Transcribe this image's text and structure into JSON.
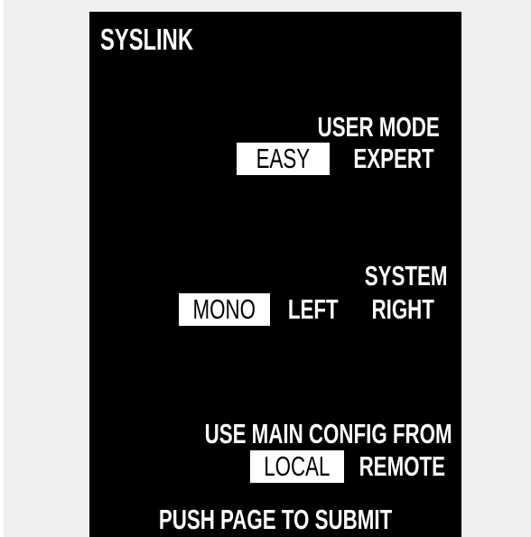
{
  "app": {
    "title": "SYSLINK"
  },
  "user_mode": {
    "label": "USER MODE",
    "options": [
      "EASY",
      "EXPERT"
    ],
    "selected": "EASY"
  },
  "system": {
    "label": "SYSTEM",
    "options": [
      "MONO",
      "LEFT",
      "RIGHT"
    ],
    "selected": "MONO"
  },
  "main_config": {
    "label": "USE MAIN CONFIG FROM",
    "options": [
      "LOCAL",
      "REMOTE"
    ],
    "selected": "LOCAL"
  },
  "footer": {
    "hint": "PUSH PAGE TO SUBMIT"
  },
  "colors": {
    "screen_background": "#000000",
    "text": "#ffffff",
    "selected_background": "#ffffff",
    "selected_text": "#000000",
    "outer_background": "#f0f0f0"
  }
}
